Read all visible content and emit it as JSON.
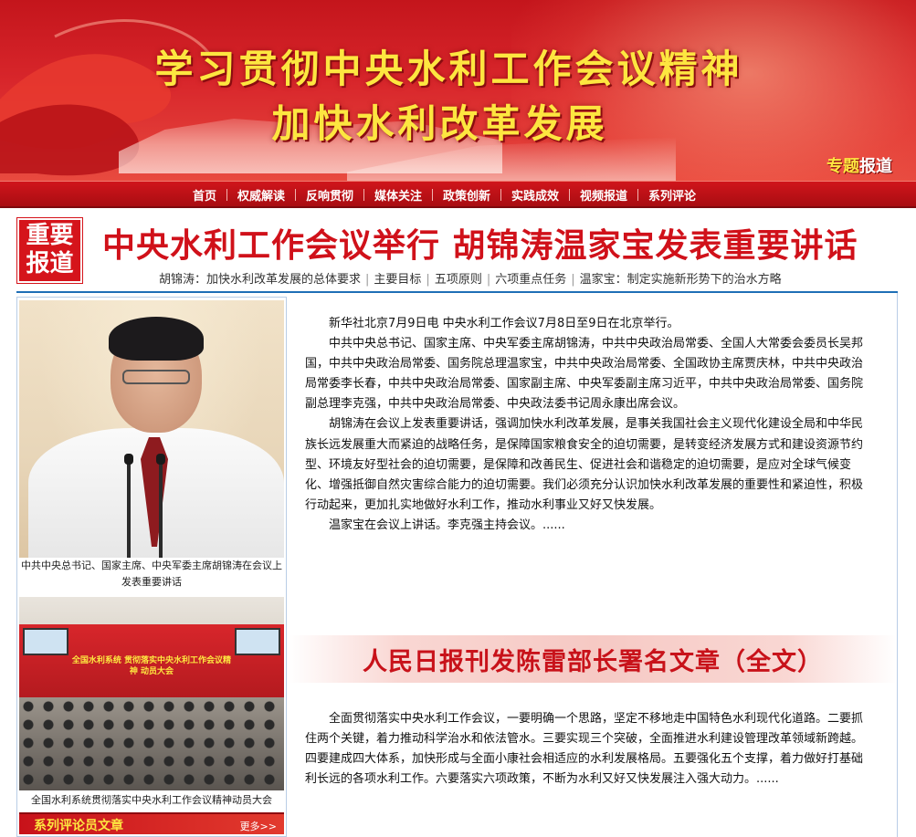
{
  "banner": {
    "title_line1": "学习贯彻中央水利工作会议精神",
    "title_line2": "加快水利改革发展",
    "badge_part1": "专题",
    "badge_part2": "报道"
  },
  "nav": {
    "items": [
      {
        "label": "首页"
      },
      {
        "label": "权威解读"
      },
      {
        "label": "反响贯彻"
      },
      {
        "label": "媒体关注"
      },
      {
        "label": "政策创新"
      },
      {
        "label": "实践成效"
      },
      {
        "label": "视频报道"
      },
      {
        "label": "系列评论"
      }
    ]
  },
  "headline": {
    "badge_line1": "重要",
    "badge_line2": "报道",
    "title": "中央水利工作会议举行  胡锦涛温家宝发表重要讲话",
    "sublinks": [
      {
        "label": "胡锦涛：加快水利改革发展的总体要求"
      },
      {
        "label": "主要目标"
      },
      {
        "label": "五项原则"
      },
      {
        "label": "六项重点任务"
      },
      {
        "label": "温家宝：制定实施新形势下的治水方略"
      }
    ]
  },
  "left": {
    "photo1_caption": "中共中央总书记、国家主席、中央军委主席胡锦涛在会议上发表重要讲话",
    "photo2_banner": "全国水利系统 贯彻落实中央水利工作会议精神 动员大会",
    "photo2_caption": "全国水利系统贯彻落实中央水利工作会议精神动员大会",
    "series_title": "系列评论员文章",
    "series_more": "更多>>"
  },
  "article": {
    "paragraphs": [
      "新华社北京7月9日电 中央水利工作会议7月8日至9日在北京举行。",
      "中共中央总书记、国家主席、中央军委主席胡锦涛，中共中央政治局常委、全国人大常委会委员长吴邦国，中共中央政治局常委、国务院总理温家宝，中共中央政治局常委、全国政协主席贾庆林，中共中央政治局常委李长春，中共中央政治局常委、国家副主席、中央军委副主席习近平，中共中央政治局常委、国务院副总理李克强，中共中央政治局常委、中央政法委书记周永康出席会议。",
      "胡锦涛在会议上发表重要讲话，强调加快水利改革发展，是事关我国社会主义现代化建设全局和中华民族长远发展重大而紧迫的战略任务，是保障国家粮食安全的迫切需要，是转变经济发展方式和建设资源节约型、环境友好型社会的迫切需要，是保障和改善民生、促进社会和谐稳定的迫切需要，是应对全球气候变化、增强抵御自然灾害综合能力的迫切需要。我们必须充分认识加快水利改革发展的重要性和紧迫性，积极行动起来，更加扎实地做好水利工作，推动水利事业又好又快发展。",
      "温家宝在会议上讲话。李克强主持会议。......"
    ]
  },
  "article2": {
    "title": "人民日报刊发陈雷部长署名文章（全文）",
    "paragraph": "全面贯彻落实中央水利工作会议，一要明确一个思路，坚定不移地走中国特色水利现代化道路。二要抓住两个关键，着力推动科学治水和依法管水。三要实现三个突破，全面推进水利建设管理改革领域新跨越。四要建成四大体系，加快形成与全面小康社会相适应的水利发展格局。五要强化五个支撑，着力做好打基础利长远的各项水利工作。六要落实六项政策，不断为水利又好又快发展注入强大动力。......"
  },
  "colors": {
    "brand_red": "#d0111a",
    "banner_yellow": "#fde640",
    "frame_blue": "#1e6fb6"
  }
}
